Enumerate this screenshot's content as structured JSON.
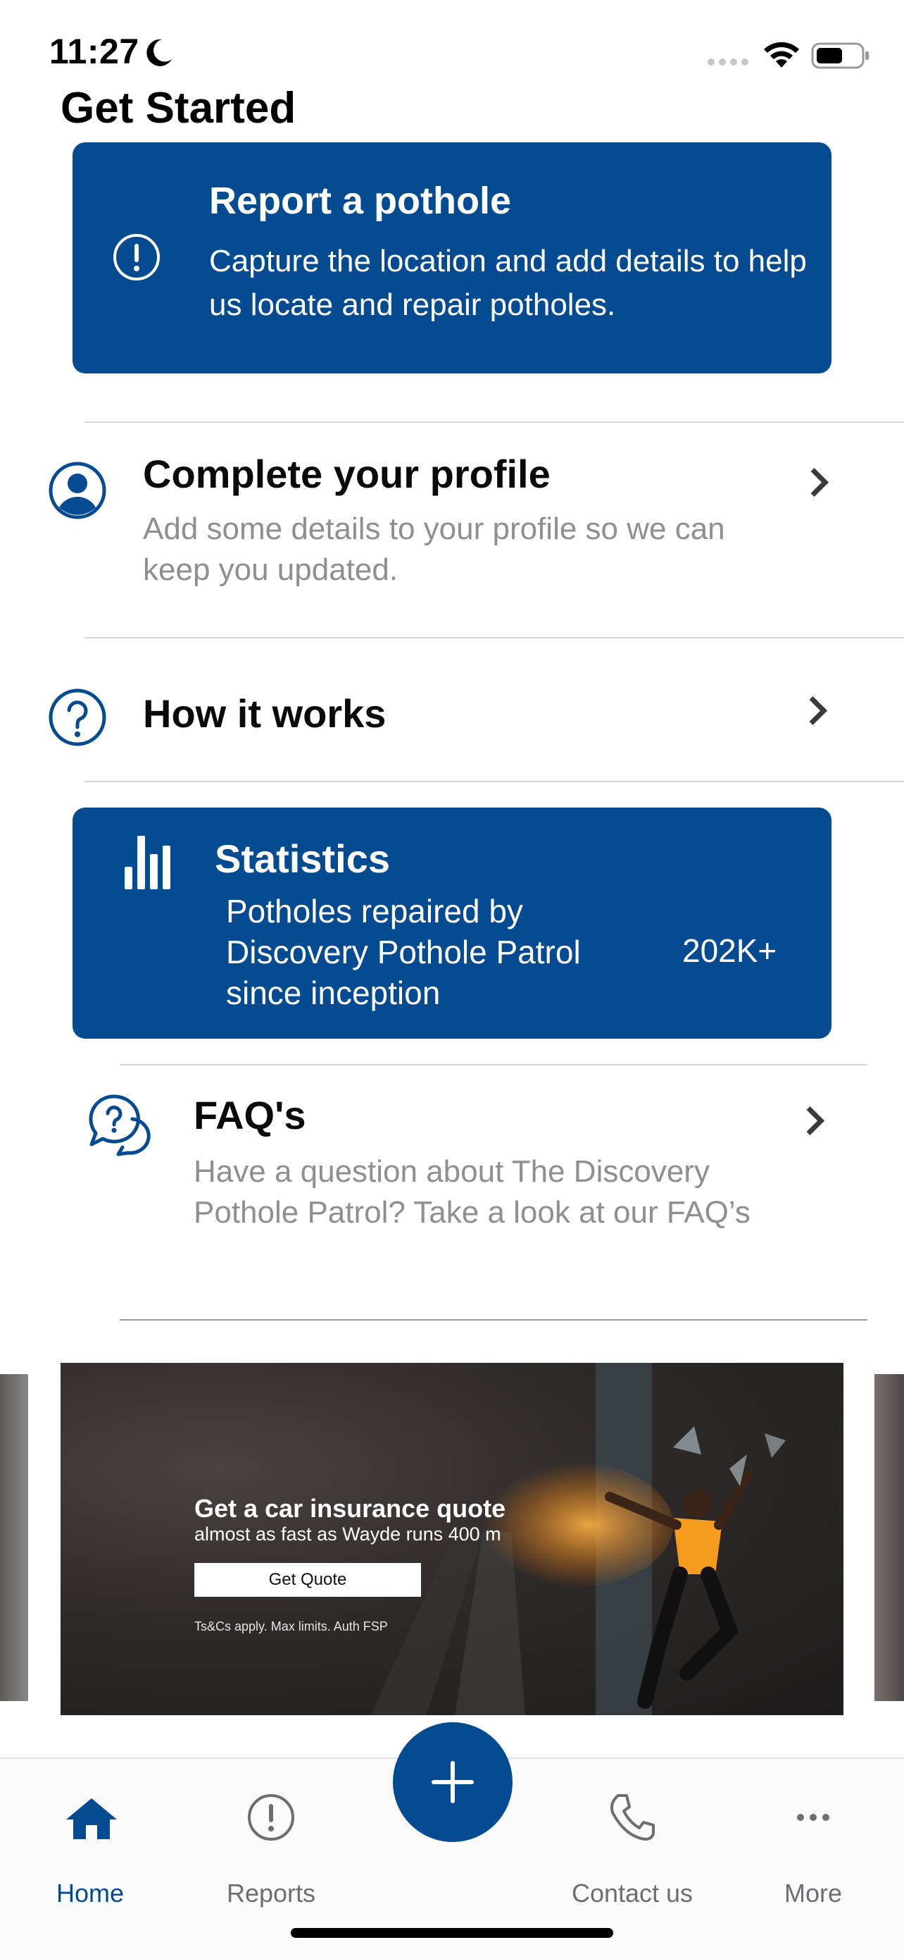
{
  "status_bar": {
    "time": "11:27"
  },
  "section_heading": "Get Started",
  "report_card": {
    "title": "Report a pothole",
    "description": "Capture the location and add details to help us locate and repair potholes."
  },
  "profile_row": {
    "title": "Complete your profile",
    "description": "Add some details to your profile so we can keep you updated."
  },
  "how_row": {
    "title": "How it works"
  },
  "stats_card": {
    "title": "Statistics",
    "description": "Potholes repaired by Discovery Pothole Patrol since inception",
    "value": "202K+"
  },
  "faq_row": {
    "title": "FAQ's",
    "description": "Have a question about The Discovery Pothole Patrol? Take a look at our FAQ’s"
  },
  "banner": {
    "title": "Get a car insurance quote",
    "subtitle": "almost as fast as Wayde runs 400 m",
    "button_label": "Get  Quote",
    "terms": "Ts&Cs apply. Max limits. Auth FSP"
  },
  "tab_bar": {
    "tabs": [
      {
        "label": "Home",
        "icon": "home-icon",
        "active": true
      },
      {
        "label": "Reports",
        "icon": "alert-circle-icon",
        "active": false
      },
      {
        "label": "Contact us",
        "icon": "phone-icon",
        "active": false
      },
      {
        "label": "More",
        "icon": "more-dots-icon",
        "active": false
      }
    ],
    "fab_icon": "plus-icon"
  },
  "colors": {
    "brand_blue": "#044b92",
    "active_tab": "#044b92",
    "inactive_tab": "#6d6d72"
  }
}
